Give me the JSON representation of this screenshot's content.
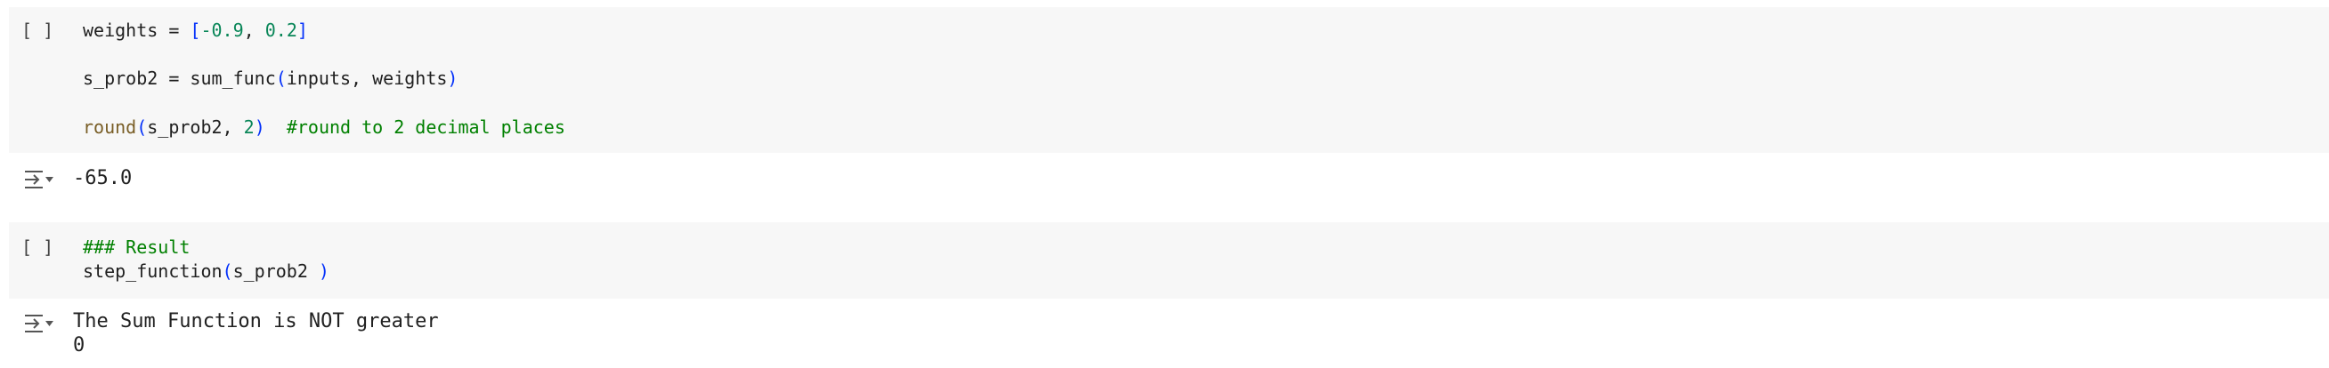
{
  "cell1": {
    "run_button": "[ ]",
    "line1": {
      "var": "weights = ",
      "open": "[",
      "n1": "-0.9",
      "sep": ", ",
      "n2": "0.2",
      "close": "]"
    },
    "line2": {
      "a": "s_prob2 = sum_func",
      "open": "(",
      "args": "inputs, weights",
      "close": ")"
    },
    "line3": {
      "fn": "round",
      "open": "(",
      "arg": "s_prob2, ",
      "num": "2",
      "close": ")",
      "comment": "  #round to 2 decimal places"
    }
  },
  "output1": {
    "icon": "output-toggle-icon",
    "text": "-65.0"
  },
  "cell2": {
    "run_button": "[ ]",
    "comment_line": "### Result",
    "line2": {
      "fn": "step_function",
      "open": "(",
      "arg": "s_prob2 ",
      "close": ")"
    }
  },
  "output2": {
    "icon": "output-toggle-icon",
    "line1": "The Sum Function is NOT greater",
    "line2": "0"
  },
  "colors": {
    "cell_bg": "#f7f7f7",
    "comment": "#008000",
    "number": "#098658",
    "bracket": "#0431fa",
    "function": "#795e26"
  }
}
